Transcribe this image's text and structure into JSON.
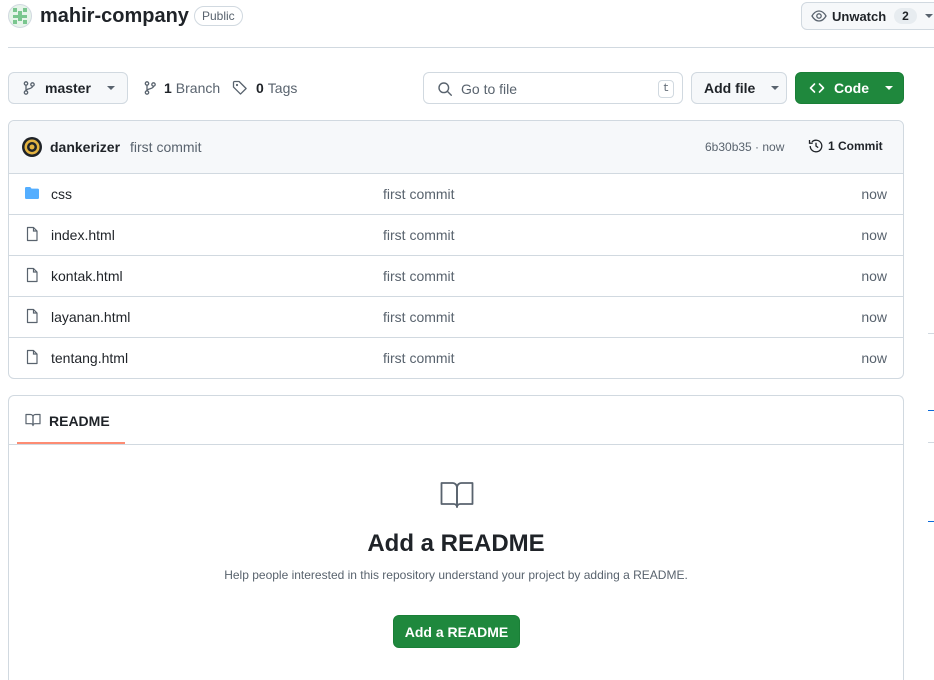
{
  "repo": {
    "name": "mahir-company",
    "visibility": "Public",
    "watch_label": "Unwatch",
    "watch_count": "2"
  },
  "toolbar": {
    "branch": "master",
    "branch_count": "1",
    "branch_label": "Branch",
    "tag_count": "0",
    "tag_label": "Tags",
    "search_placeholder": "Go to file",
    "search_shortcut": "t",
    "add_file_label": "Add file",
    "code_label": "Code"
  },
  "commit": {
    "author": "dankerizer",
    "message": "first commit",
    "hash_time": "6b30b35 · now",
    "commits_label": "1 Commit"
  },
  "files": [
    {
      "name": "css",
      "type": "folder",
      "message": "first commit",
      "age": "now"
    },
    {
      "name": "index.html",
      "type": "file",
      "message": "first commit",
      "age": "now"
    },
    {
      "name": "kontak.html",
      "type": "file",
      "message": "first commit",
      "age": "now"
    },
    {
      "name": "layanan.html",
      "type": "file",
      "message": "first commit",
      "age": "now"
    },
    {
      "name": "tentang.html",
      "type": "file",
      "message": "first commit",
      "age": "now"
    }
  ],
  "readme": {
    "tab_label": "README",
    "heading": "Add a README",
    "description": "Help people interested in this repository understand your project by adding a README.",
    "button_label": "Add a README"
  },
  "colors": {
    "accent_green": "#1f883d",
    "tab_underline": "#fd8c73",
    "folder_blue": "#54aeff"
  }
}
